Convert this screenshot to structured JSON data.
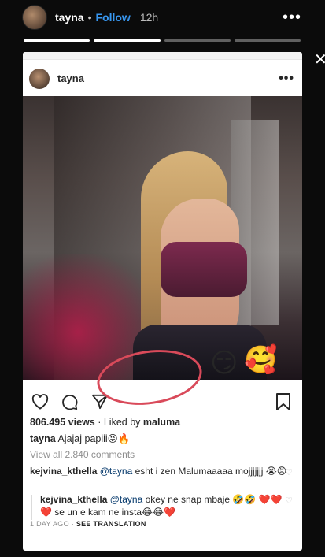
{
  "story": {
    "username": "tayna",
    "follow_label": "Follow",
    "time": "12h",
    "progress": [
      1,
      1,
      0,
      0
    ]
  },
  "post": {
    "username": "tayna",
    "emojis": [
      "😏",
      "🥰"
    ],
    "views": "806.495 views",
    "liked_by_prefix": "Liked by",
    "liked_by_user": "maluma",
    "caption_user": "tayna",
    "caption_text": "Ajajaj papiii😜🔥",
    "view_all_comments": "View all 2.840 comments",
    "comments": [
      {
        "user": "kejvina_kthella",
        "mention": "@tayna",
        "text": "esht i zen Malumaaaaa mojjjjjjj 😭😡"
      },
      {
        "user": "kejvina_kthella",
        "mention": "@tayna",
        "text": "okey ne snap mbaje 🤣🤣 ❤️❤️❤️ se un e kam ne insta😂😂❤️"
      }
    ],
    "timestamp": "1 DAY AGO",
    "see_translation": "SEE TRANSLATION"
  },
  "colors": {
    "follow": "#3897f0",
    "annotation_circle": "#d94a5a"
  }
}
